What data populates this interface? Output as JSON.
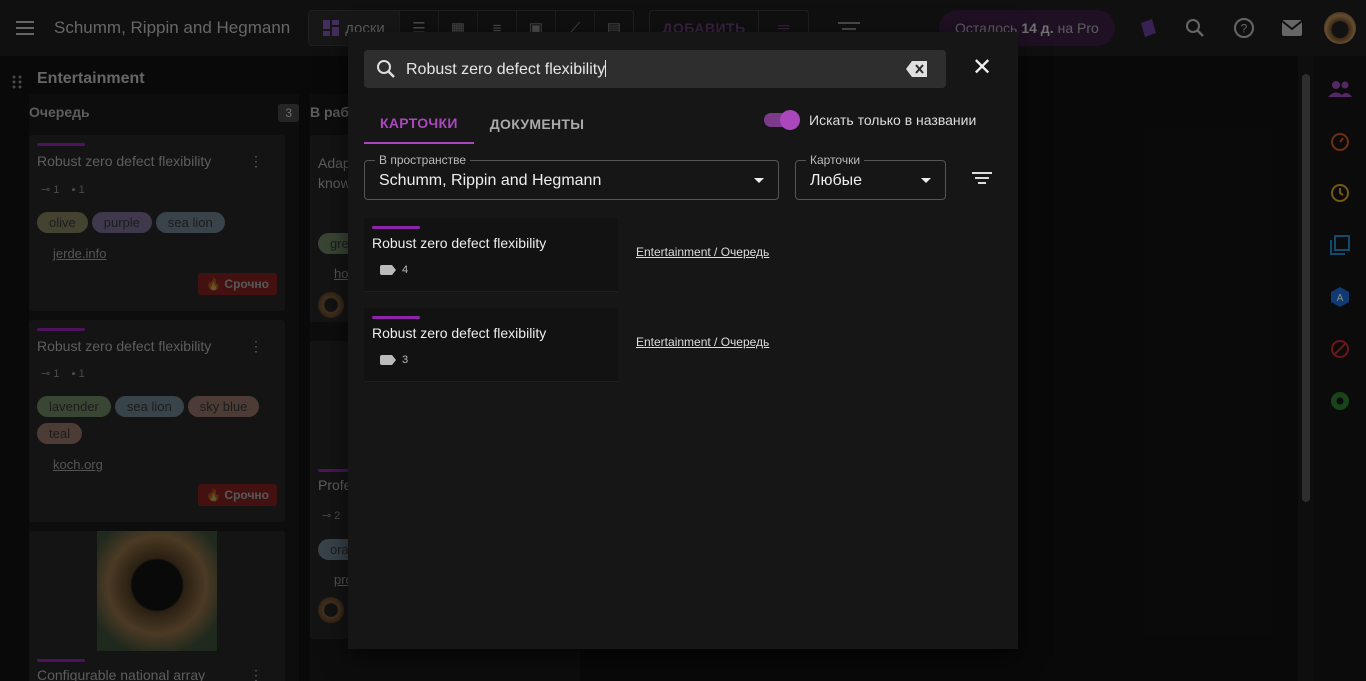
{
  "topbar": {
    "workspace_name": "Schumm, Rippin and Hegmann",
    "views": {
      "boards_label": "доски"
    },
    "add_label": "ДОБАВИТЬ",
    "pro": {
      "prefix": "Осталось",
      "days": "14 д.",
      "suffix": "на Pro"
    }
  },
  "board": {
    "title": "Entertainment",
    "columns": [
      {
        "title": "Очередь",
        "count": "3"
      },
      {
        "title": "В рабо"
      }
    ],
    "cards": [
      {
        "title": "Robust zero defect flexibility",
        "attachments": "1",
        "comments": "1",
        "tags": [
          "olive",
          "purple",
          "sea lion"
        ],
        "link": "jerde.info",
        "badge": "Срочно"
      },
      {
        "title": "Robust zero defect flexibility",
        "attachments": "1",
        "comments": "1",
        "tags": [
          "lavender",
          "sea lion",
          "sky blue",
          "teal"
        ],
        "link": "koch.org",
        "badge": "Срочно"
      },
      {
        "title": "Configurable national array"
      }
    ],
    "col2_cards": [
      {
        "title_line1": "Adap",
        "title_line2": "know",
        "tag": "gre",
        "link": "ho"
      },
      {
        "title": "Profe",
        "count": "2",
        "tag": "ora",
        "link": "pro"
      }
    ]
  },
  "search_dialog": {
    "query": "Robust zero defect flexibility",
    "tabs": [
      "КАРТОЧКИ",
      "ДОКУМЕНТЫ"
    ],
    "title_only_label": "Искать только в названии",
    "title_only_enabled": true,
    "space_field": {
      "label": "В пространстве",
      "value": "Schumm, Rippin and Hegmann"
    },
    "cards_field": {
      "label": "Карточки",
      "value": "Любые"
    },
    "results": [
      {
        "title": "Robust zero defect flexibility",
        "tag_count": "4",
        "path": "Entertainment / Очередь"
      },
      {
        "title": "Robust zero defect flexibility",
        "tag_count": "3",
        "path": "Entertainment / Очередь"
      }
    ]
  },
  "colors": {
    "accent": "#ab47bc",
    "stripe": "#8e24aa",
    "urgent": "#b71c1c",
    "tag_olive": "#c5c08a",
    "tag_purple": "#b39ddb",
    "tag_sea_lion": "#9fb8c8",
    "tag_lavender": "#a5c49a",
    "tag_sky_blue": "#d9a990",
    "tag_teal": "#d9a990"
  },
  "icons": {
    "rail": [
      "people-icon",
      "timer-icon",
      "history-icon",
      "layers-icon",
      "ai-badge-icon",
      "block-icon",
      "aperture-icon"
    ],
    "topbar": [
      "puzzle-icon",
      "search-icon",
      "help-icon",
      "mail-icon"
    ]
  }
}
